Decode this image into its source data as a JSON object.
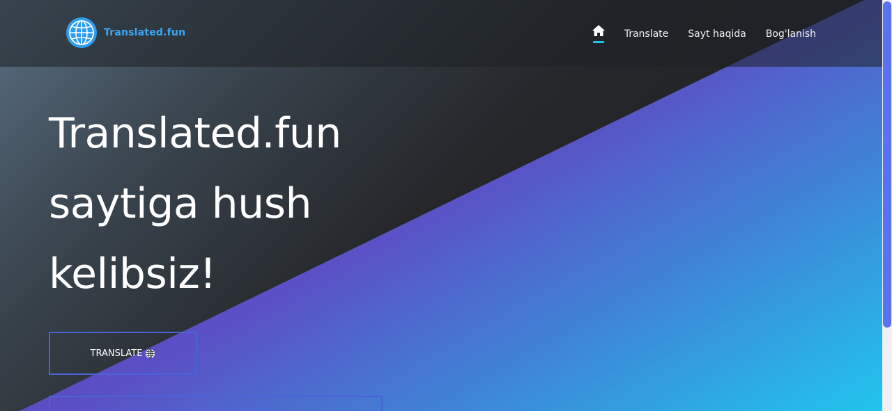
{
  "brand": {
    "name": "Translated.fun",
    "logo_icon": "globe-icon",
    "color": "#3aa7f5"
  },
  "nav": {
    "home_icon": "home-icon",
    "items": [
      {
        "label": "Translate"
      },
      {
        "label": "Sayt haqida"
      },
      {
        "label": "Bog'lanish"
      }
    ]
  },
  "hero": {
    "title_line1": "Translated.fun",
    "title_line2": "saytiga hush",
    "title_line3": "kelibsiz!",
    "button_label": "TRANSLATE",
    "button_icon": "globe-icon"
  },
  "colors": {
    "accent": "#22c3e8",
    "button_border": "#4a63d6",
    "gradient_start": "#6a2fbf",
    "gradient_end": "#20c6ee",
    "scrollbar": "#5a72f0"
  }
}
